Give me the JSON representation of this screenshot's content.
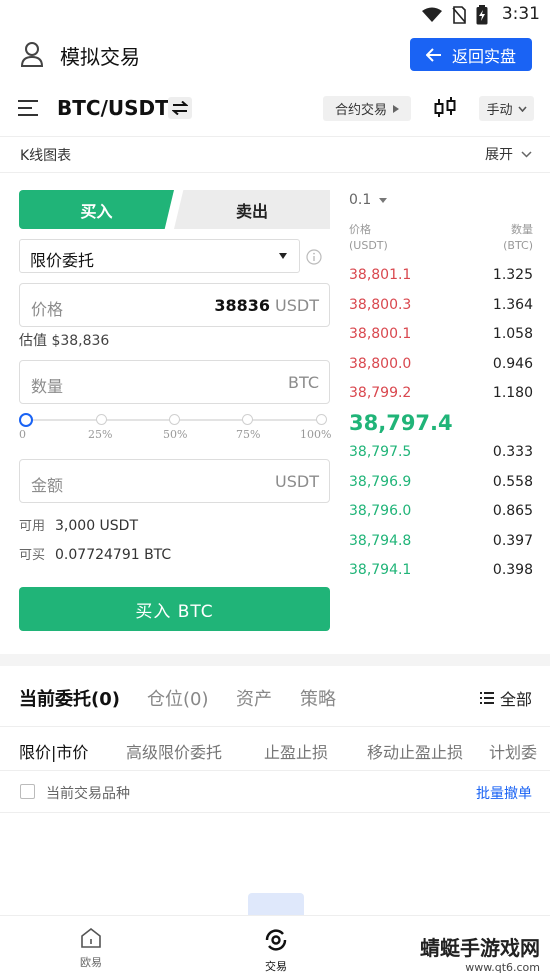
{
  "status_bar": {
    "time": "3:31"
  },
  "header": {
    "title": "模拟交易",
    "back_label": "返回实盘"
  },
  "pair_bar": {
    "pair": "BTC/USDT",
    "contract_label": "合约交易",
    "mode_label": "手动"
  },
  "kline": {
    "label": "K线图表",
    "expand_label": "展开"
  },
  "trade": {
    "buy_tab": "买入",
    "sell_tab": "卖出",
    "order_type": "限价委托",
    "price_placeholder": "价格",
    "price_value": "38836",
    "price_unit": "USDT",
    "estimate": "估值 $38,836",
    "amount_placeholder": "数量",
    "amount_unit": "BTC",
    "slider_percent": 0,
    "slider_labels": [
      "0",
      "25%",
      "50%",
      "75%",
      "100%"
    ],
    "total_placeholder": "金额",
    "total_unit": "USDT",
    "available_label": "可用",
    "available_value": "3,000 USDT",
    "can_buy_label": "可买",
    "can_buy_value": "0.07724791 BTC",
    "buy_button": "买入 BTC"
  },
  "order_book": {
    "depth": "0.1",
    "price_header": "价格",
    "price_unit": "(USDT)",
    "qty_header": "数量",
    "qty_unit": "(BTC)",
    "asks": [
      {
        "price": "38,801.1",
        "qty": "1.325"
      },
      {
        "price": "38,800.3",
        "qty": "1.364"
      },
      {
        "price": "38,800.1",
        "qty": "1.058"
      },
      {
        "price": "38,800.0",
        "qty": "0.946"
      },
      {
        "price": "38,799.2",
        "qty": "1.180"
      }
    ],
    "last_price": "38,797.4",
    "bids": [
      {
        "price": "38,797.5",
        "qty": "0.333"
      },
      {
        "price": "38,796.9",
        "qty": "0.558"
      },
      {
        "price": "38,796.0",
        "qty": "0.865"
      },
      {
        "price": "38,794.8",
        "qty": "0.397"
      },
      {
        "price": "38,794.1",
        "qty": "0.398"
      }
    ]
  },
  "orders": {
    "tabs": [
      "当前委托(0)",
      "仓位(0)",
      "资产",
      "策略"
    ],
    "all_label": "全部",
    "sub_tabs": [
      "限价|市价",
      "高级限价委托",
      "止盈止损",
      "移动止盈止损",
      "计划委"
    ],
    "filter_label": "当前交易品种",
    "cancel_all": "批量撤单"
  },
  "bottom_nav": {
    "items": [
      "欧易",
      "交易"
    ]
  },
  "watermark": {
    "text": "蜻蜓手游戏网",
    "url": "www.qt6.com"
  },
  "colors": {
    "buy": "#20b478",
    "sell": "#d9474e",
    "accent": "#1a63f4"
  }
}
